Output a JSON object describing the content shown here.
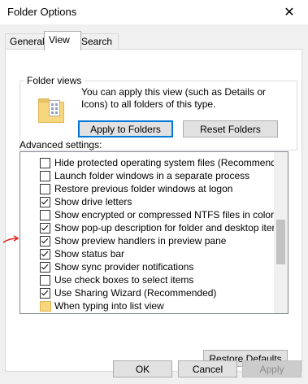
{
  "window": {
    "title": "Folder Options",
    "close_glyph": "✕"
  },
  "tabs": [
    "General",
    "View",
    "Search"
  ],
  "folder_views": {
    "label": "Folder views",
    "description": "You can apply this view (such as Details or Icons) to all folders of this type.",
    "apply_button": "Apply to Folders",
    "reset_button": "Reset Folders"
  },
  "advanced": {
    "label": "Advanced settings:",
    "items": [
      {
        "label": "Hide protected operating system files (Recommended)",
        "checked": false,
        "type": "checkbox"
      },
      {
        "label": "Launch folder windows in a separate process",
        "checked": false,
        "type": "checkbox"
      },
      {
        "label": "Restore previous folder windows at logon",
        "checked": false,
        "type": "checkbox"
      },
      {
        "label": "Show drive letters",
        "checked": true,
        "type": "checkbox"
      },
      {
        "label": "Show encrypted or compressed NTFS files in color",
        "checked": false,
        "type": "checkbox"
      },
      {
        "label": "Show pop-up description for folder and desktop items",
        "checked": true,
        "type": "checkbox"
      },
      {
        "label": "Show preview handlers in preview pane",
        "checked": true,
        "type": "checkbox"
      },
      {
        "label": "Show status bar",
        "checked": true,
        "type": "checkbox"
      },
      {
        "label": "Show sync provider notifications",
        "checked": true,
        "type": "checkbox"
      },
      {
        "label": "Use check boxes to select items",
        "checked": false,
        "type": "checkbox"
      },
      {
        "label": "Use Sharing Wizard (Recommended)",
        "checked": true,
        "type": "checkbox"
      },
      {
        "label": "When typing into list view",
        "checked": null,
        "type": "folder"
      }
    ],
    "restore_button": "Restore Defaults"
  },
  "footer": {
    "ok": "OK",
    "cancel": "Cancel",
    "apply": "Apply"
  },
  "colors": {
    "accent": "#0078d7",
    "annotation_arrow": "#e02020"
  }
}
